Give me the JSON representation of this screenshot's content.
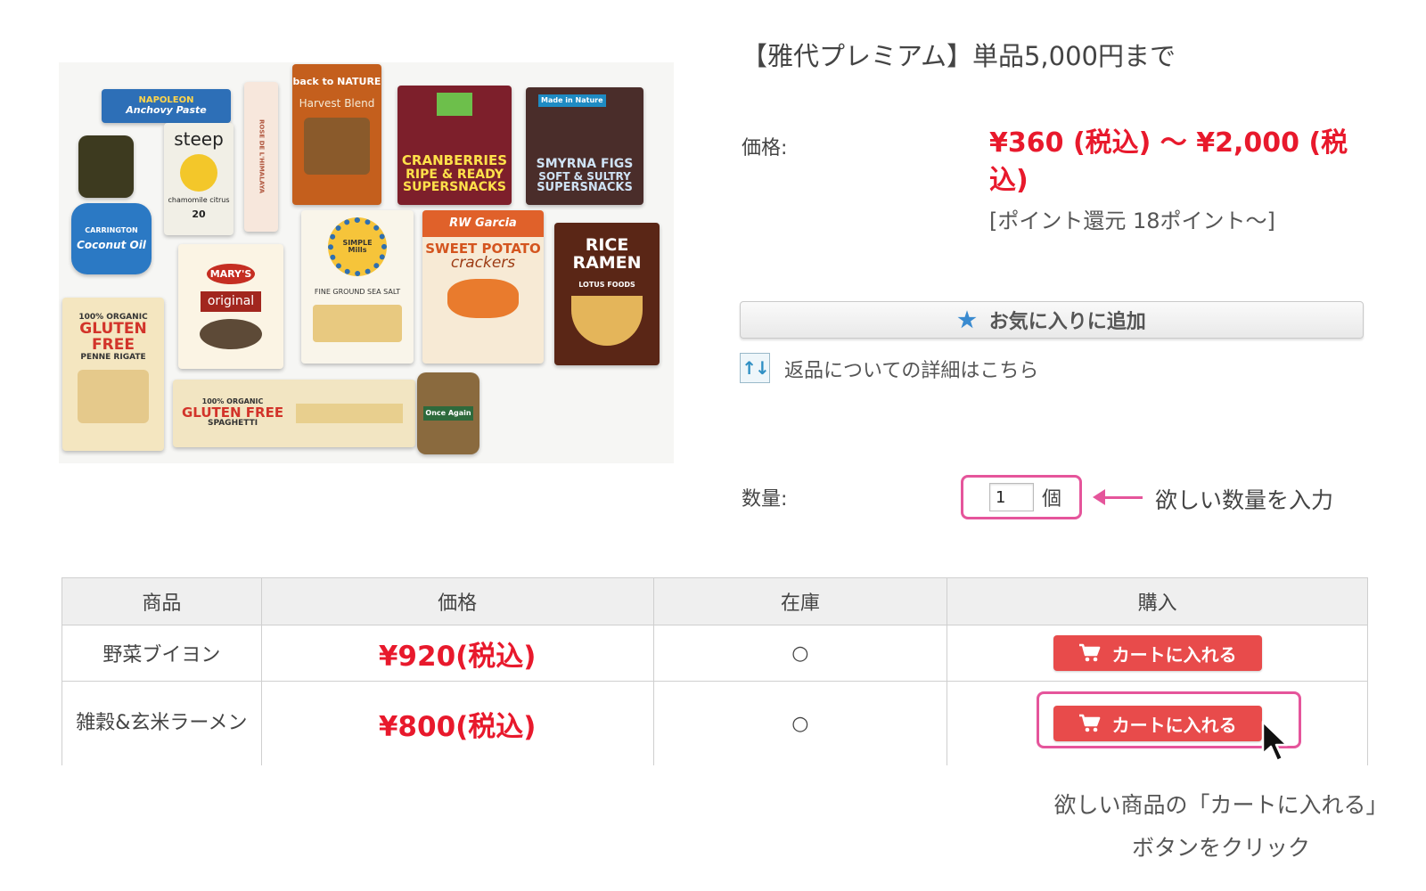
{
  "product": {
    "title": "【雅代プレミアム】単品5,000円まで",
    "price_label": "価格:",
    "price_range": "¥360 (税込) ～ ¥2,000 (税込)",
    "points": "[ポイント還元 18ポイント～]",
    "favorite_label": "お気に入りに追加",
    "return_link": "返品についての詳細はこちら"
  },
  "image_labels": {
    "napoleon": "NAPOLEON",
    "anchovy": "Anchovy Paste",
    "steep": "steep",
    "steep_sub": "chamomile citrus",
    "steep_num": "20",
    "harvest_brand": "back to NATURE",
    "harvest": "Harvest Blend",
    "cranberries": "CRANBERRIES",
    "ripe_ready": "RIPE & READY",
    "supersnacks": "SUPERSNACKS",
    "smyrna": "SMYRNA FIGS",
    "soft_sultry": "SOFT & SULTRY",
    "made_nature": "Made in Nature",
    "coconut_brand": "CARRINGTON",
    "coconut": "Coconut Oil",
    "marys": "MARY'S",
    "original": "original",
    "simple": "SIMPLE Mills",
    "sea_salt": "FINE GROUND SEA SALT",
    "rwgarcia": "RW Garcia",
    "sweet_potato": "SWEET POTATO",
    "crackers": "crackers",
    "rice_ramen": "RICE RAMEN",
    "lotus": "LOTUS FOODS",
    "gluten_free": "GLUTEN FREE",
    "penne": "PENNE RIGATE",
    "spaghetti": "SPAGHETTI",
    "organic_100": "100% ORGANIC",
    "once_again": "Once Again",
    "himalaya": "ROSE DE L'HIMALAYA"
  },
  "quantity": {
    "label": "数量:",
    "value": "1",
    "unit": "個",
    "hint": "欲しい数量を入力"
  },
  "table": {
    "headers": [
      "商品",
      "価格",
      "在庫",
      "購入"
    ],
    "rows": [
      {
        "name": "野菜ブイヨン",
        "price": "¥920",
        "tax": "(税込)",
        "stock": "○",
        "button": "カートに入れる"
      },
      {
        "name": "雑穀&玄米ラーメン",
        "price": "¥800",
        "tax": "(税込)",
        "stock": "○",
        "button": "カートに入れる"
      }
    ]
  },
  "cart_hint": {
    "line1": "欲しい商品の「カートに入れる」",
    "line2": "ボタンをクリック"
  },
  "colors": {
    "price_red": "#e8192c",
    "cart_button": "#e84b4b",
    "highlight_pink": "#e5559b",
    "star_blue": "#3a8bd0"
  },
  "icons": [
    "star-icon",
    "sort-arrows-icon",
    "cart-icon",
    "arrow-left-icon",
    "mouse-cursor-icon"
  ]
}
